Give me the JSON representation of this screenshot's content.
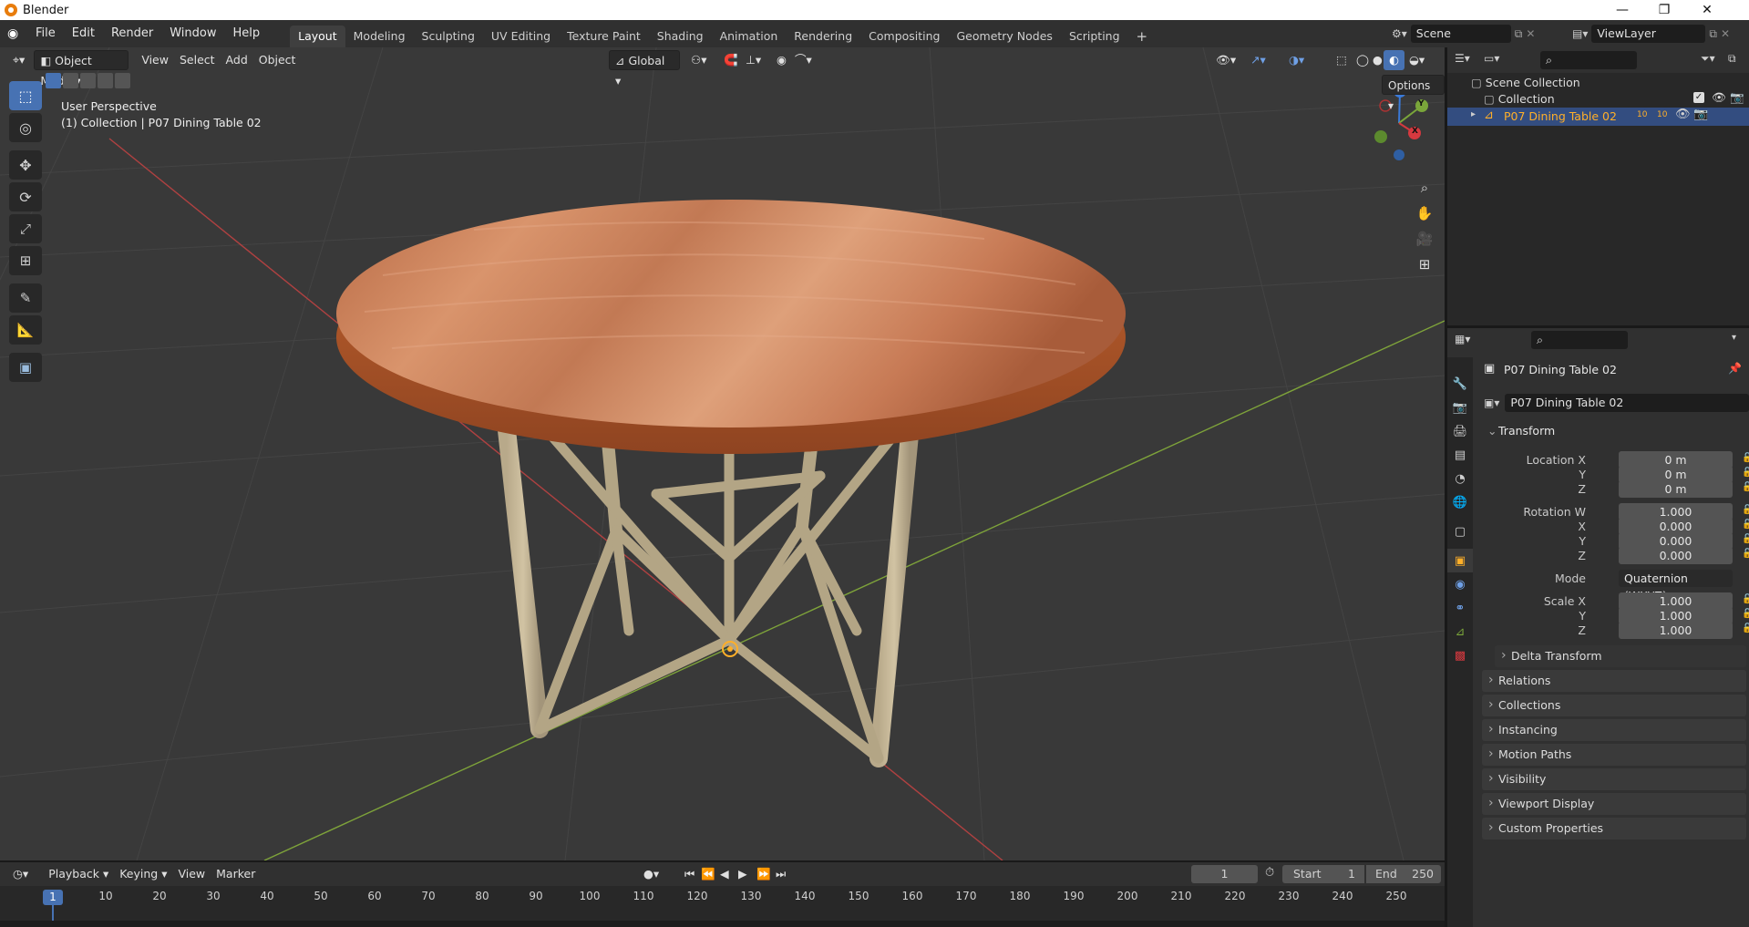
{
  "app": {
    "title": "Blender"
  },
  "menus": [
    "File",
    "Edit",
    "Render",
    "Window",
    "Help"
  ],
  "workspaces": [
    {
      "label": "Layout",
      "active": true
    },
    {
      "label": "Modeling"
    },
    {
      "label": "Sculpting"
    },
    {
      "label": "UV Editing"
    },
    {
      "label": "Texture Paint"
    },
    {
      "label": "Shading"
    },
    {
      "label": "Animation"
    },
    {
      "label": "Rendering"
    },
    {
      "label": "Compositing"
    },
    {
      "label": "Geometry Nodes"
    },
    {
      "label": "Scripting"
    }
  ],
  "scene": {
    "name": "Scene",
    "view_layer": "ViewLayer"
  },
  "viewport": {
    "mode": "Object Mode",
    "menus": [
      "View",
      "Select",
      "Add",
      "Object"
    ],
    "transform_orientation": "Global",
    "options_label": "Options",
    "overlay_title": "User Perspective",
    "overlay_subtitle": "(1) Collection | P07 Dining Table 02",
    "gizmo": {
      "x": "X",
      "y": "Y",
      "z": "Z"
    }
  },
  "outliner": {
    "root": "Scene Collection",
    "collection": "Collection",
    "object": "P07 Dining Table 02",
    "object_badge1": "10",
    "object_badge2": "10"
  },
  "properties": {
    "object_name": "P07 Dining Table 02",
    "data_name": "P07 Dining Table 02",
    "transform_label": "Transform",
    "location": {
      "label_x": "Location X",
      "label_y": "Y",
      "label_z": "Z",
      "x": "0 m",
      "y": "0 m",
      "z": "0 m"
    },
    "rotation": {
      "label_w": "Rotation W",
      "label_x": "X",
      "label_y": "Y",
      "label_z": "Z",
      "w": "1.000",
      "x": "0.000",
      "y": "0.000",
      "z": "0.000"
    },
    "mode_label": "Mode",
    "mode_value": "Quaternion (WXYZ)",
    "scale": {
      "label_x": "Scale X",
      "label_y": "Y",
      "label_z": "Z",
      "x": "1.000",
      "y": "1.000",
      "z": "1.000"
    },
    "subpanels": [
      "Delta Transform"
    ],
    "panels": [
      "Relations",
      "Collections",
      "Instancing",
      "Motion Paths",
      "Visibility",
      "Viewport Display",
      "Custom Properties"
    ]
  },
  "timeline": {
    "menus": [
      "Playback",
      "Keying",
      "View",
      "Marker"
    ],
    "current_frame": "1",
    "start_label": "Start",
    "start": "1",
    "end_label": "End",
    "end": "250",
    "ticks": [
      "10",
      "20",
      "30",
      "40",
      "50",
      "60",
      "70",
      "80",
      "90",
      "100",
      "110",
      "120",
      "130",
      "140",
      "150",
      "160",
      "170",
      "180",
      "190",
      "200",
      "210",
      "220",
      "230",
      "240",
      "250"
    ],
    "marker": "1"
  },
  "colors": {
    "accent": "#4772b3",
    "selected_text": "#ffaf29",
    "header": "#303030",
    "viewport": "#393939"
  }
}
